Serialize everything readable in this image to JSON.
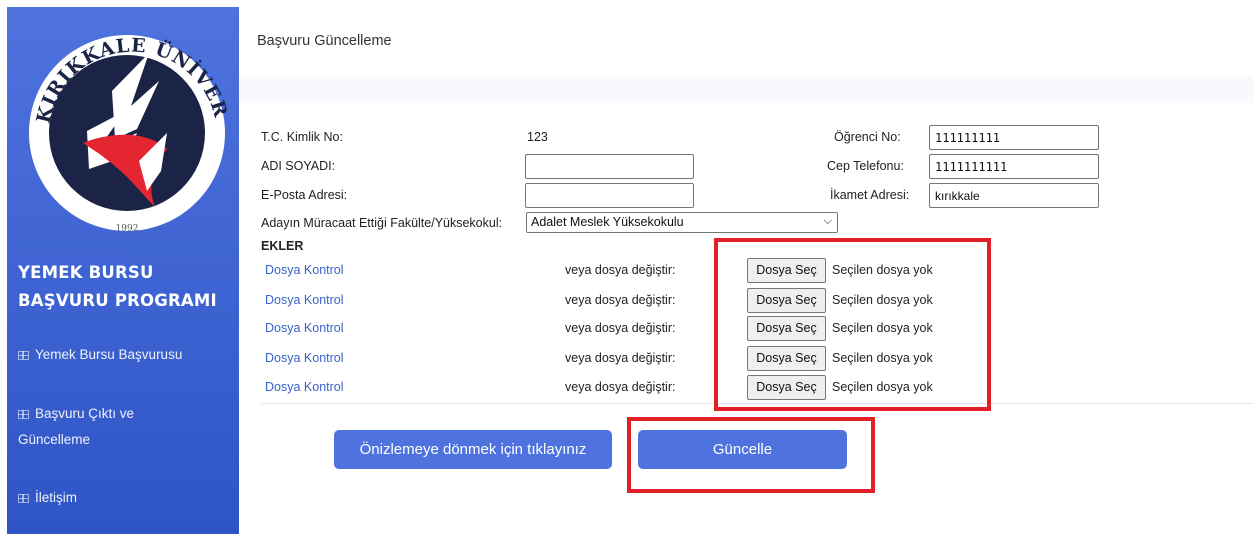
{
  "sidebar": {
    "logo_text": "KIRIKKALE ÜNİVERSİTESİ",
    "logo_year": "1992",
    "title_line1": "YEMEK BURSU",
    "title_line2": "BAŞVURU PROGRAMI",
    "items": [
      {
        "label": "Yemek Bursu Başvurusu",
        "icon": "grid-icon"
      },
      {
        "label": "Başvuru Çıktı ve",
        "label2": "Güncelleme",
        "icon": "grid-icon"
      },
      {
        "label": "İletişim",
        "icon": "grid-icon"
      }
    ]
  },
  "header": {
    "title": "Başvuru Güncelleme"
  },
  "form": {
    "tc_label": "T.C. Kimlik No:",
    "tc_value": "123",
    "name_label": "ADI SOYADI:",
    "name_value": "",
    "email_label": "E-Posta Adresi:",
    "email_value": "",
    "student_no_label": "Öğrenci No:",
    "student_no_value": "111111111",
    "phone_label": "Cep Telefonu:",
    "phone_value": "1111111111",
    "address_label": "İkamet Adresi:",
    "address_value": "kırıkkale",
    "faculty_label": "Adayın Müracaat Ettiği Fakülte/Yüksekokul:",
    "faculty_value": "Adalet Meslek Yüksekokulu"
  },
  "attachments": {
    "heading": "EKLER",
    "rows": [
      {
        "link": "Dosya Kontrol",
        "or_text": "veya dosya değiştir:",
        "button": "Dosya Seç",
        "status": "Seçilen dosya yok"
      },
      {
        "link": "Dosya Kontrol",
        "or_text": "veya dosya değiştir:",
        "button": "Dosya Seç",
        "status": "Seçilen dosya yok"
      },
      {
        "link": "Dosya Kontrol",
        "or_text": "veya dosya değiştir:",
        "button": "Dosya Seç",
        "status": "Seçilen dosya yok"
      },
      {
        "link": "Dosya Kontrol",
        "or_text": "veya dosya değiştir:",
        "button": "Dosya Seç",
        "status": "Seçilen dosya yok"
      },
      {
        "link": "Dosya Kontrol",
        "or_text": "veya dosya değiştir:",
        "button": "Dosya Seç",
        "status": "Seçilen dosya yok"
      }
    ]
  },
  "actions": {
    "preview_button": "Önizlemeye dönmek için tıklayınız",
    "update_button": "Güncelle"
  },
  "colors": {
    "primary": "#4e73df",
    "highlight": "#e32027",
    "link": "#3a63c9"
  }
}
